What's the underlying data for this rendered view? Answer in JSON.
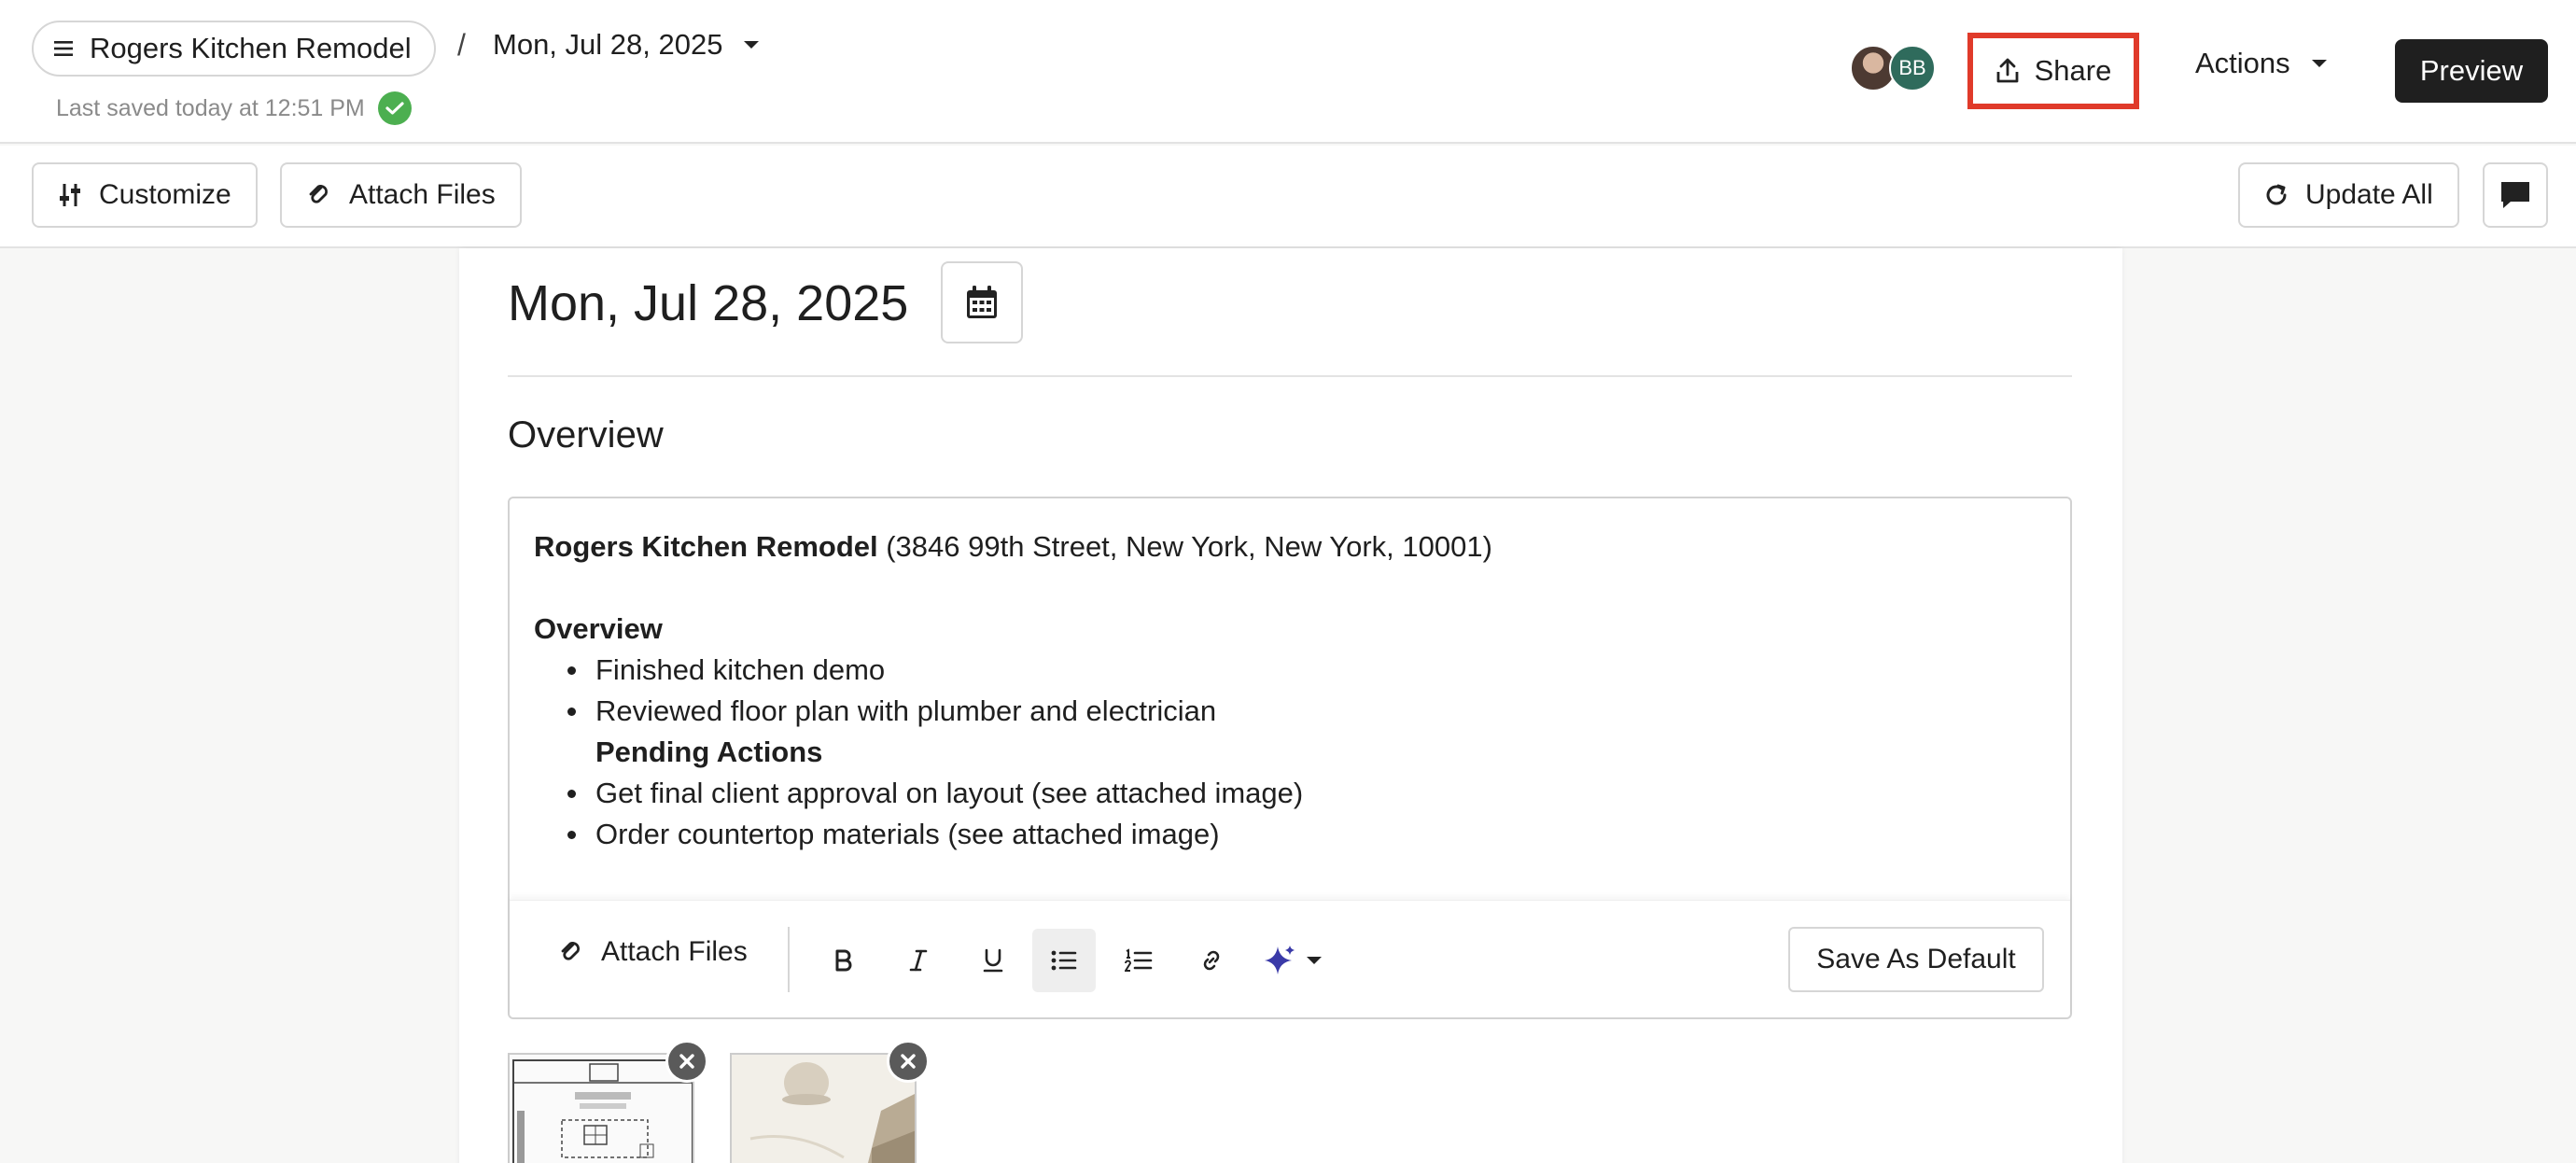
{
  "header": {
    "project_title": "Rogers Kitchen Remodel",
    "separator": "/",
    "date_label": "Mon, Jul 28, 2025",
    "last_saved": "Last saved today at 12:51 PM",
    "avatar_initials": "BB",
    "share_label": "Share",
    "actions_label": "Actions",
    "preview_label": "Preview"
  },
  "toolbar": {
    "customize_label": "Customize",
    "attach_label": "Attach Files",
    "update_all_label": "Update All"
  },
  "main": {
    "date_heading": "Mon, Jul 28, 2025",
    "section_title": "Overview",
    "editor": {
      "project_name": "Rogers Kitchen Remodel",
      "address": " (3846 99th Street, New York, New York, 10001)",
      "overview_label": "Overview",
      "bullets_a": [
        "Finished kitchen demo",
        "Reviewed floor plan with plumber and electrician"
      ],
      "pending_label": "Pending Actions",
      "bullets_b": [
        "Get final client approval on layout (see attached image)",
        "Order countertop materials (see attached image)"
      ]
    },
    "editor_toolbar": {
      "attach_label": "Attach Files",
      "save_default_label": "Save As Default"
    }
  },
  "colors": {
    "share_highlight": "#e03a2a",
    "preview_bg": "#1f1f1f",
    "saved_check": "#4caf50",
    "avatar_bb": "#2f6b5c",
    "ai_sparkle": "#3a3aa8"
  }
}
